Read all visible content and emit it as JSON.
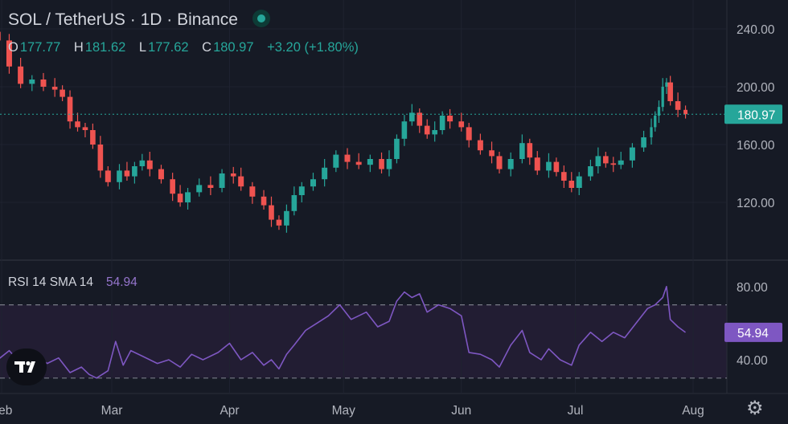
{
  "header": {
    "title": "SOL / TetherUS · 1D · Binance",
    "ohlc": [
      {
        "key": "O",
        "value": "177.77"
      },
      {
        "key": "H",
        "value": "181.62"
      },
      {
        "key": "L",
        "value": "177.62"
      },
      {
        "key": "C",
        "value": "180.97"
      },
      {
        "key": "",
        "value": "+3.20 (+1.80%)"
      }
    ]
  },
  "rsi_label": {
    "name": "RSI 14 SMA 14",
    "value": "54.94"
  },
  "colors": {
    "up": "#26a69a",
    "down": "#ef5350",
    "rsi": "#7e57c2",
    "bg": "#161a25",
    "rsi_band": "#221d33"
  },
  "icons": {
    "logo": "tradingview-logo",
    "settings": "gear-icon"
  },
  "chart_data": [
    {
      "type": "candlestick",
      "title": "SOL / TetherUS · 1D · Binance",
      "yaxis": {
        "ticks": [
          120,
          160,
          200,
          240
        ],
        "tick_labels": [
          "120.00",
          "160.00",
          "200.00",
          "240.00"
        ],
        "ylim": [
          100,
          250
        ]
      },
      "xaxis": {
        "tick_labels": [
          "Feb",
          "Mar",
          "Apr",
          "May",
          "Jun",
          "Jul",
          "Aug"
        ],
        "tick_dates": [
          "2024-02-01",
          "2024-03-01",
          "2024-04-01",
          "2024-05-01",
          "2024-06-01",
          "2024-07-01",
          "2024-08-01"
        ]
      },
      "last_price": {
        "label": "180.97",
        "value": 180.97
      },
      "closes": [
        {
          "date": "2024-01-31",
          "close": 232
        },
        {
          "date": "2024-02-03",
          "close": 214
        },
        {
          "date": "2024-02-06",
          "close": 202
        },
        {
          "date": "2024-02-09",
          "close": 205
        },
        {
          "date": "2024-02-12",
          "close": 200
        },
        {
          "date": "2024-02-15",
          "close": 198
        },
        {
          "date": "2024-02-17",
          "close": 193
        },
        {
          "date": "2024-02-19",
          "close": 176
        },
        {
          "date": "2024-02-21",
          "close": 172
        },
        {
          "date": "2024-02-23",
          "close": 170
        },
        {
          "date": "2024-02-25",
          "close": 160
        },
        {
          "date": "2024-02-27",
          "close": 142
        },
        {
          "date": "2024-02-29",
          "close": 134
        },
        {
          "date": "2024-03-03",
          "close": 142
        },
        {
          "date": "2024-03-05",
          "close": 138
        },
        {
          "date": "2024-03-07",
          "close": 145
        },
        {
          "date": "2024-03-09",
          "close": 149
        },
        {
          "date": "2024-03-11",
          "close": 143
        },
        {
          "date": "2024-03-14",
          "close": 136
        },
        {
          "date": "2024-03-17",
          "close": 126
        },
        {
          "date": "2024-03-19",
          "close": 120
        },
        {
          "date": "2024-03-21",
          "close": 127
        },
        {
          "date": "2024-03-24",
          "close": 132
        },
        {
          "date": "2024-03-27",
          "close": 130
        },
        {
          "date": "2024-03-30",
          "close": 140
        },
        {
          "date": "2024-04-02",
          "close": 138
        },
        {
          "date": "2024-04-04",
          "close": 131
        },
        {
          "date": "2024-04-07",
          "close": 124
        },
        {
          "date": "2024-04-10",
          "close": 118
        },
        {
          "date": "2024-04-12",
          "close": 108
        },
        {
          "date": "2024-04-14",
          "close": 104
        },
        {
          "date": "2024-04-16",
          "close": 114
        },
        {
          "date": "2024-04-18",
          "close": 125
        },
        {
          "date": "2024-04-20",
          "close": 131
        },
        {
          "date": "2024-04-23",
          "close": 136
        },
        {
          "date": "2024-04-26",
          "close": 144
        },
        {
          "date": "2024-04-29",
          "close": 153
        },
        {
          "date": "2024-05-02",
          "close": 148
        },
        {
          "date": "2024-05-05",
          "close": 146
        },
        {
          "date": "2024-05-08",
          "close": 150
        },
        {
          "date": "2024-05-11",
          "close": 143
        },
        {
          "date": "2024-05-13",
          "close": 150
        },
        {
          "date": "2024-05-15",
          "close": 164
        },
        {
          "date": "2024-05-17",
          "close": 176
        },
        {
          "date": "2024-05-19",
          "close": 182
        },
        {
          "date": "2024-05-21",
          "close": 173
        },
        {
          "date": "2024-05-23",
          "close": 167
        },
        {
          "date": "2024-05-25",
          "close": 170
        },
        {
          "date": "2024-05-27",
          "close": 180
        },
        {
          "date": "2024-05-29",
          "close": 176
        },
        {
          "date": "2024-06-01",
          "close": 172
        },
        {
          "date": "2024-06-03",
          "close": 163
        },
        {
          "date": "2024-06-06",
          "close": 156
        },
        {
          "date": "2024-06-09",
          "close": 152
        },
        {
          "date": "2024-06-11",
          "close": 143
        },
        {
          "date": "2024-06-14",
          "close": 150
        },
        {
          "date": "2024-06-17",
          "close": 161
        },
        {
          "date": "2024-06-19",
          "close": 151
        },
        {
          "date": "2024-06-21",
          "close": 142
        },
        {
          "date": "2024-06-24",
          "close": 148
        },
        {
          "date": "2024-06-26",
          "close": 141
        },
        {
          "date": "2024-06-28",
          "close": 135
        },
        {
          "date": "2024-06-30",
          "close": 130
        },
        {
          "date": "2024-07-02",
          "close": 138
        },
        {
          "date": "2024-07-05",
          "close": 145
        },
        {
          "date": "2024-07-07",
          "close": 152
        },
        {
          "date": "2024-07-09",
          "close": 147
        },
        {
          "date": "2024-07-11",
          "close": 146
        },
        {
          "date": "2024-07-13",
          "close": 149
        },
        {
          "date": "2024-07-16",
          "close": 158
        },
        {
          "date": "2024-07-19",
          "close": 165
        },
        {
          "date": "2024-07-21",
          "close": 172
        },
        {
          "date": "2024-07-22",
          "close": 180
        },
        {
          "date": "2024-07-23",
          "close": 186
        },
        {
          "date": "2024-07-24",
          "close": 200
        },
        {
          "date": "2024-07-25",
          "close": 203
        },
        {
          "date": "2024-07-26",
          "close": 190
        },
        {
          "date": "2024-07-28",
          "close": 184
        },
        {
          "date": "2024-07-30",
          "close": 181
        }
      ]
    },
    {
      "type": "line",
      "title": "RSI 14 SMA 14",
      "yaxis": {
        "ticks": [
          40,
          80
        ],
        "tick_labels": [
          "40.00",
          "80.00"
        ],
        "ylim": [
          20,
          90
        ],
        "band": [
          30,
          70
        ]
      },
      "last_value": {
        "label": "54.94",
        "value": 54.94
      },
      "series": [
        {
          "name": "RSI 14",
          "color": "#7e57c2",
          "points": [
            {
              "date": "2024-01-31",
              "value": 40
            },
            {
              "date": "2024-02-03",
              "value": 45
            },
            {
              "date": "2024-02-06",
              "value": 38
            },
            {
              "date": "2024-02-09",
              "value": 44
            },
            {
              "date": "2024-02-13",
              "value": 38
            },
            {
              "date": "2024-02-16",
              "value": 41
            },
            {
              "date": "2024-02-19",
              "value": 33
            },
            {
              "date": "2024-02-22",
              "value": 36
            },
            {
              "date": "2024-02-24",
              "value": 32
            },
            {
              "date": "2024-02-26",
              "value": 30
            },
            {
              "date": "2024-02-29",
              "value": 34
            },
            {
              "date": "2024-03-02",
              "value": 50
            },
            {
              "date": "2024-03-04",
              "value": 37
            },
            {
              "date": "2024-03-06",
              "value": 45
            },
            {
              "date": "2024-03-09",
              "value": 42
            },
            {
              "date": "2024-03-13",
              "value": 38
            },
            {
              "date": "2024-03-16",
              "value": 40
            },
            {
              "date": "2024-03-19",
              "value": 36
            },
            {
              "date": "2024-03-22",
              "value": 43
            },
            {
              "date": "2024-03-25",
              "value": 40
            },
            {
              "date": "2024-03-29",
              "value": 44
            },
            {
              "date": "2024-04-01",
              "value": 49
            },
            {
              "date": "2024-04-04",
              "value": 40
            },
            {
              "date": "2024-04-07",
              "value": 44
            },
            {
              "date": "2024-04-10",
              "value": 37
            },
            {
              "date": "2024-04-12",
              "value": 40
            },
            {
              "date": "2024-04-14",
              "value": 35
            },
            {
              "date": "2024-04-16",
              "value": 43
            },
            {
              "date": "2024-04-18",
              "value": 48
            },
            {
              "date": "2024-04-21",
              "value": 56
            },
            {
              "date": "2024-04-24",
              "value": 60
            },
            {
              "date": "2024-04-27",
              "value": 64
            },
            {
              "date": "2024-04-30",
              "value": 70
            },
            {
              "date": "2024-05-03",
              "value": 62
            },
            {
              "date": "2024-05-07",
              "value": 66
            },
            {
              "date": "2024-05-10",
              "value": 58
            },
            {
              "date": "2024-05-13",
              "value": 61
            },
            {
              "date": "2024-05-15",
              "value": 72
            },
            {
              "date": "2024-05-17",
              "value": 77
            },
            {
              "date": "2024-05-19",
              "value": 74
            },
            {
              "date": "2024-05-21",
              "value": 76
            },
            {
              "date": "2024-05-23",
              "value": 66
            },
            {
              "date": "2024-05-26",
              "value": 70
            },
            {
              "date": "2024-05-29",
              "value": 68
            },
            {
              "date": "2024-06-01",
              "value": 64
            },
            {
              "date": "2024-06-03",
              "value": 44
            },
            {
              "date": "2024-06-06",
              "value": 43
            },
            {
              "date": "2024-06-09",
              "value": 40
            },
            {
              "date": "2024-06-11",
              "value": 36
            },
            {
              "date": "2024-06-14",
              "value": 48
            },
            {
              "date": "2024-06-17",
              "value": 56
            },
            {
              "date": "2024-06-19",
              "value": 44
            },
            {
              "date": "2024-06-22",
              "value": 40
            },
            {
              "date": "2024-06-24",
              "value": 46
            },
            {
              "date": "2024-06-27",
              "value": 40
            },
            {
              "date": "2024-06-30",
              "value": 37
            },
            {
              "date": "2024-07-02",
              "value": 48
            },
            {
              "date": "2024-07-05",
              "value": 55
            },
            {
              "date": "2024-07-08",
              "value": 50
            },
            {
              "date": "2024-07-11",
              "value": 55
            },
            {
              "date": "2024-07-14",
              "value": 52
            },
            {
              "date": "2024-07-17",
              "value": 60
            },
            {
              "date": "2024-07-20",
              "value": 68
            },
            {
              "date": "2024-07-22",
              "value": 70
            },
            {
              "date": "2024-07-24",
              "value": 74
            },
            {
              "date": "2024-07-25",
              "value": 80
            },
            {
              "date": "2024-07-26",
              "value": 62
            },
            {
              "date": "2024-07-28",
              "value": 58
            },
            {
              "date": "2024-07-30",
              "value": 54.94
            }
          ]
        }
      ]
    }
  ]
}
